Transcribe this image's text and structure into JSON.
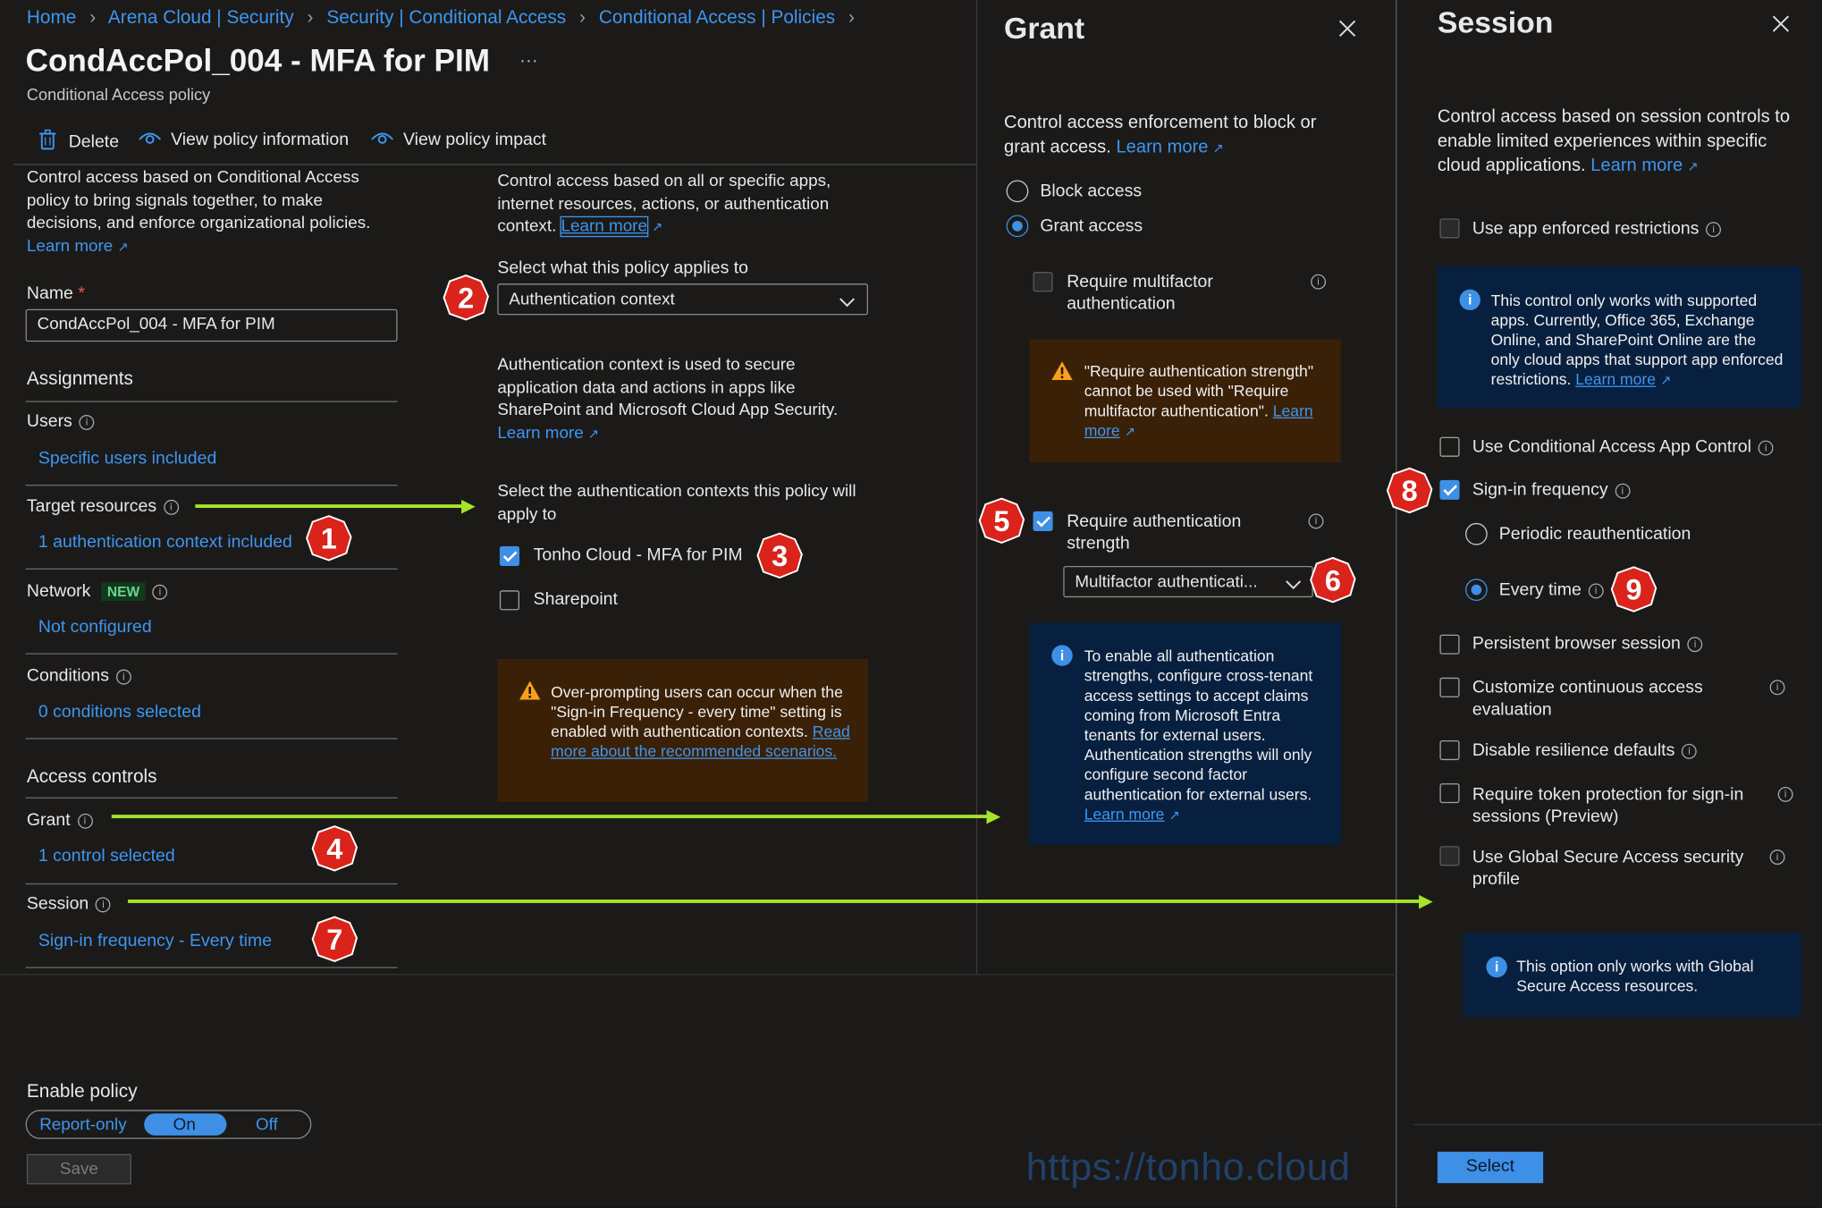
{
  "breadcrumb": [
    "Home",
    "Arena Cloud | Security",
    "Security | Conditional Access",
    "Conditional Access | Policies"
  ],
  "header": {
    "title": "CondAccPol_004 - MFA for PIM",
    "subtitle": "Conditional Access policy",
    "more": "···"
  },
  "toolbar": {
    "delete": "Delete",
    "view_info": "View policy information",
    "view_impact": "View policy impact"
  },
  "left": {
    "intro": "Control access based on Conditional Access policy to bring signals together, to make decisions, and enforce organizational policies.",
    "learn_more": "Learn more",
    "name_label": "Name",
    "required": "*",
    "name_value": "CondAccPol_004 - MFA for PIM",
    "assignments": "Assignments",
    "users_label": "Users",
    "users_value": "Specific users included",
    "target_label": "Target resources",
    "target_value": "1 authentication context included",
    "network_label": "Network",
    "network_badge": "NEW",
    "network_value": "Not configured",
    "conditions_label": "Conditions",
    "conditions_value": "0 conditions selected",
    "access_controls": "Access controls",
    "grant_label": "Grant",
    "grant_value": "1 control selected",
    "session_label": "Session",
    "session_value": "Sign-in frequency - Every time",
    "enable_policy": "Enable policy",
    "toggle": [
      "Report-only",
      "On",
      "Off"
    ],
    "save": "Save"
  },
  "middle": {
    "intro": "Control access based on all or specific apps, internet resources, actions, or authentication context.",
    "learn_more": "Learn more",
    "applies_label": "Select what this policy applies to",
    "applies_value": "Authentication context",
    "auth_ctx_desc": "Authentication context is used to secure application data and actions in apps like SharePoint and Microsoft Cloud App Security.",
    "learn_more2": "Learn more",
    "select_ctx_label": "Select the authentication contexts this policy will apply to",
    "contexts": [
      {
        "label": "Tonho Cloud - MFA for PIM",
        "checked": true
      },
      {
        "label": "Sharepoint",
        "checked": false
      }
    ],
    "warning": "Over-prompting users can occur when the \"Sign-in Frequency - every time\" setting is enabled with authentication contexts.",
    "warning_link": "Read more about the recommended scenarios."
  },
  "grant": {
    "title": "Grant",
    "intro": "Control access enforcement to block or grant access.",
    "learn_more": "Learn more",
    "block": "Block access",
    "grant": "Grant access",
    "require_mfa": "Require multifactor authentication",
    "warning": "\"Require authentication strength\" cannot be used with \"Require multifactor authentication\".",
    "warning_link": "Learn more",
    "require_strength": "Require authentication strength",
    "strength_value": "Multifactor authenticati...",
    "info": "To enable all authentication strengths, configure cross-tenant access settings to accept claims coming from Microsoft Entra tenants for external users. Authentication strengths will only configure second factor authentication for external users.",
    "info_link": "Learn more"
  },
  "session": {
    "title": "Session",
    "intro": "Control access based on session controls to enable limited experiences within specific cloud applications.",
    "learn_more": "Learn more",
    "app_enforced": "Use app enforced restrictions",
    "app_enforced_info": "This control only works with supported apps. Currently, Office 365, Exchange Online, and SharePoint Online are the only cloud apps that support app enforced restrictions.",
    "app_enforced_link": "Learn more",
    "ca_app_control": "Use Conditional Access App Control",
    "signin_freq": "Sign-in frequency",
    "periodic": "Periodic reauthentication",
    "every_time": "Every time",
    "persistent": "Persistent browser session",
    "cae": "Customize continuous access evaluation",
    "resilience": "Disable resilience defaults",
    "token_protection": "Require token protection for sign-in sessions (Preview)",
    "gsa": "Use Global Secure Access security profile",
    "gsa_info": "This option only works with Global Secure Access resources.",
    "select": "Select"
  },
  "badges": [
    "1",
    "2",
    "3",
    "4",
    "5",
    "6",
    "7",
    "8",
    "9"
  ],
  "watermark": "https://tonho.cloud",
  "colors": {
    "accent": "#3e8fe6",
    "arrow": "#a6e32a",
    "badge": "#d9231b",
    "warning_bg": "#3a2006",
    "info_bg": "#08203f"
  },
  "icons": [
    "trash-icon",
    "eye-icon",
    "info-icon",
    "warning-icon",
    "close-icon",
    "chevron-down-icon",
    "external-link-icon"
  ]
}
